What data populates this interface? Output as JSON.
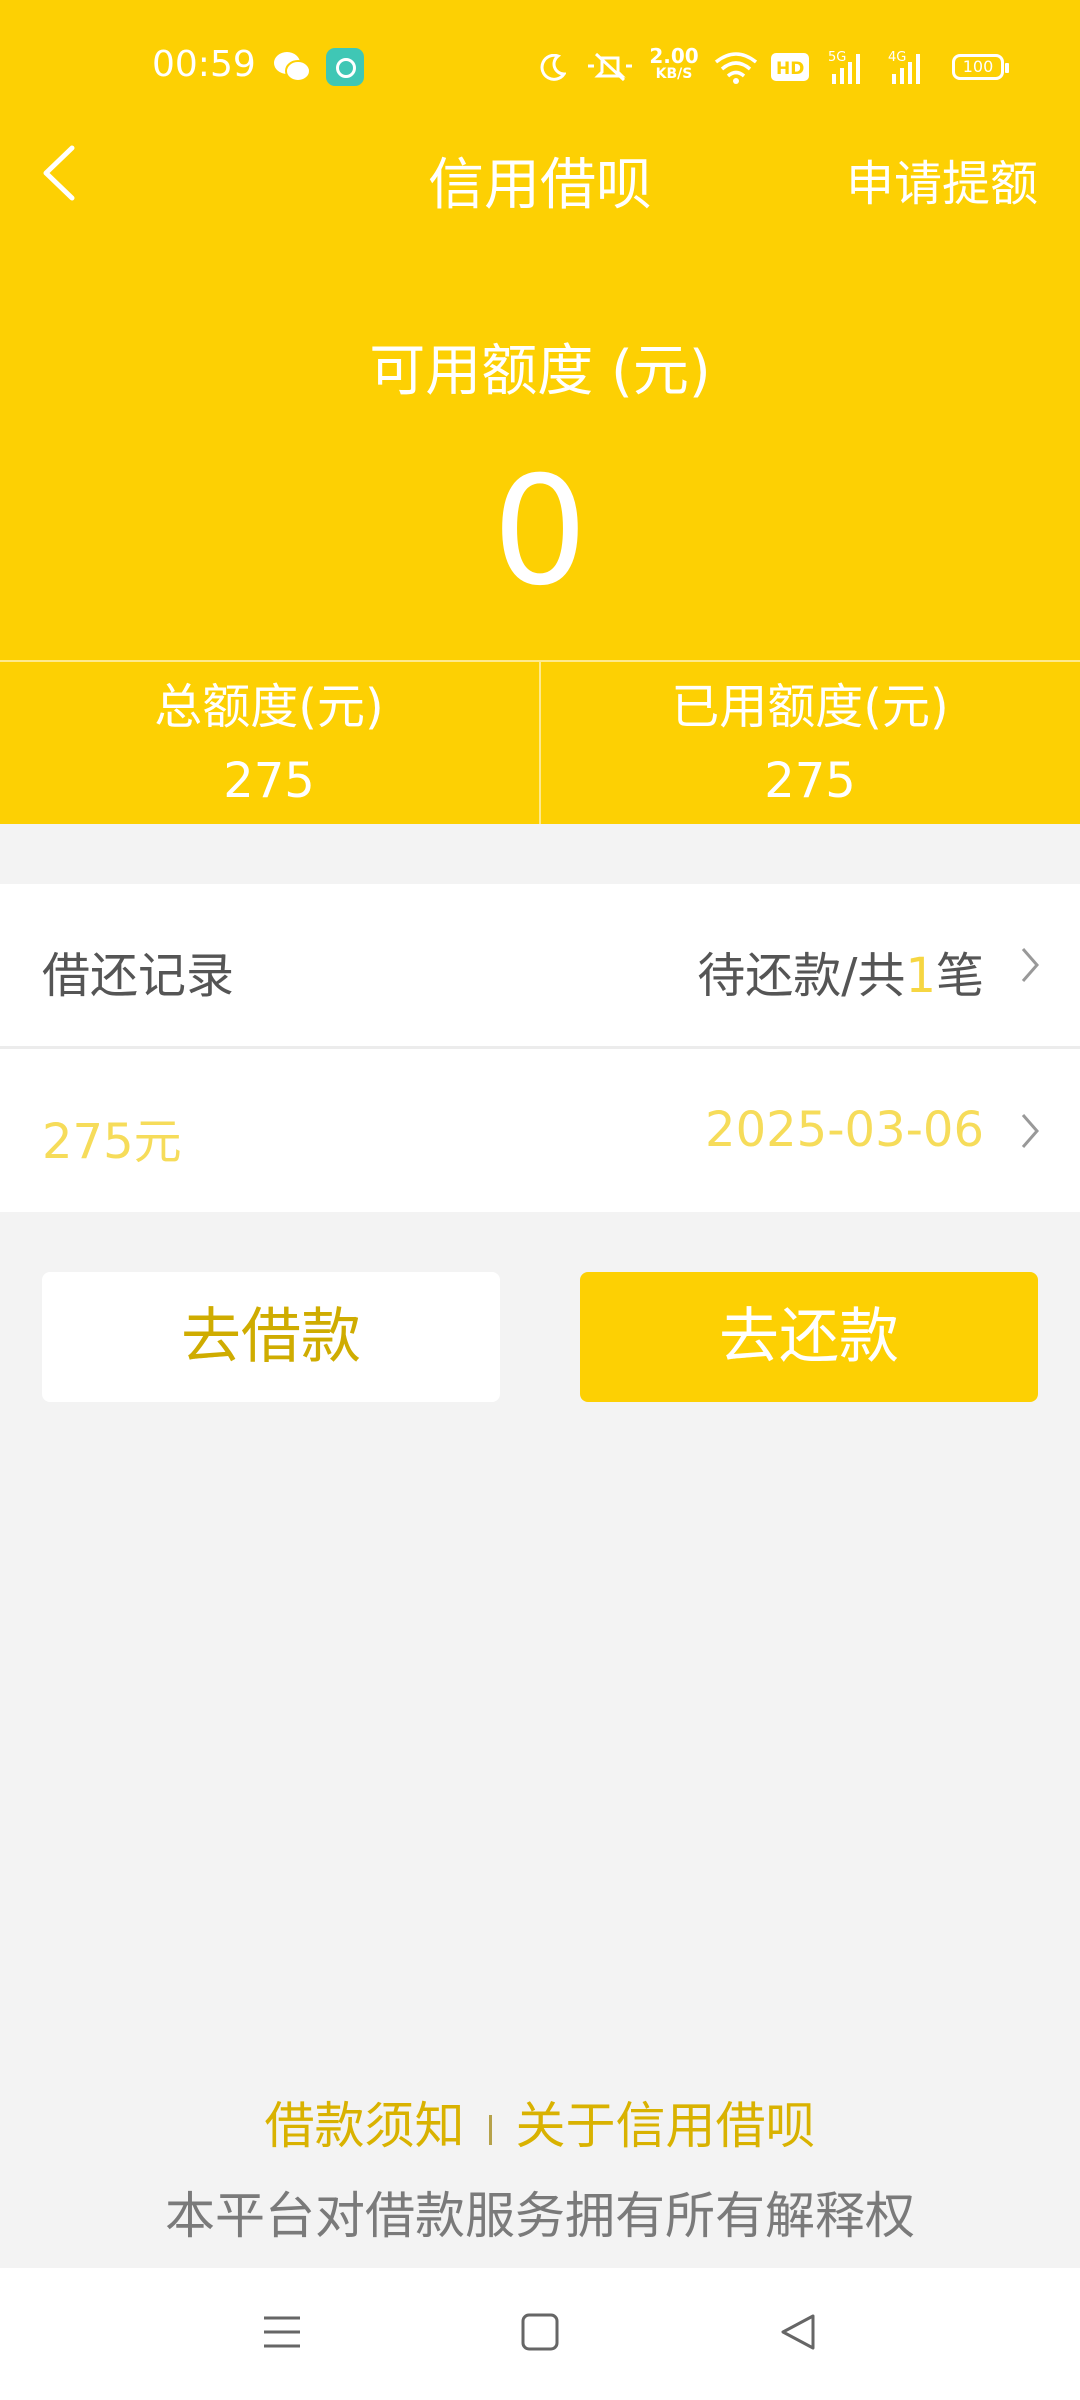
{
  "status_bar": {
    "time": "00:59",
    "net_speed_value": "2.00",
    "net_speed_unit": "KB/S",
    "battery": "100",
    "icons": [
      "wechat-icon",
      "app-badge-icon",
      "moon-icon",
      "mute-icon",
      "wifi-icon",
      "hd-icon",
      "5g-signal-icon",
      "4g-signal-icon",
      "battery-icon"
    ]
  },
  "header": {
    "title": "信用借呗",
    "apply_label": "申请提额",
    "available_label": "可用额度 (元)",
    "available_value": "0",
    "total_label": "总额度(元)",
    "total_value": "275",
    "used_label": "已用额度(元)",
    "used_value": "275"
  },
  "records": {
    "title": "借还记录",
    "status_prefix": "待还款/共",
    "status_count": "1",
    "status_suffix": "笔",
    "amount": "275元",
    "date": "2025-03-06"
  },
  "actions": {
    "borrow_label": "去借款",
    "repay_label": "去还款"
  },
  "footer": {
    "notice_link": "借款须知",
    "about_link": "关于信用借呗",
    "disclaimer": "本平台对借款服务拥有所有解释权"
  },
  "colors": {
    "brand_yellow": "#fdd003",
    "link_gold": "#d9b200",
    "background": "#f3f3f3"
  }
}
